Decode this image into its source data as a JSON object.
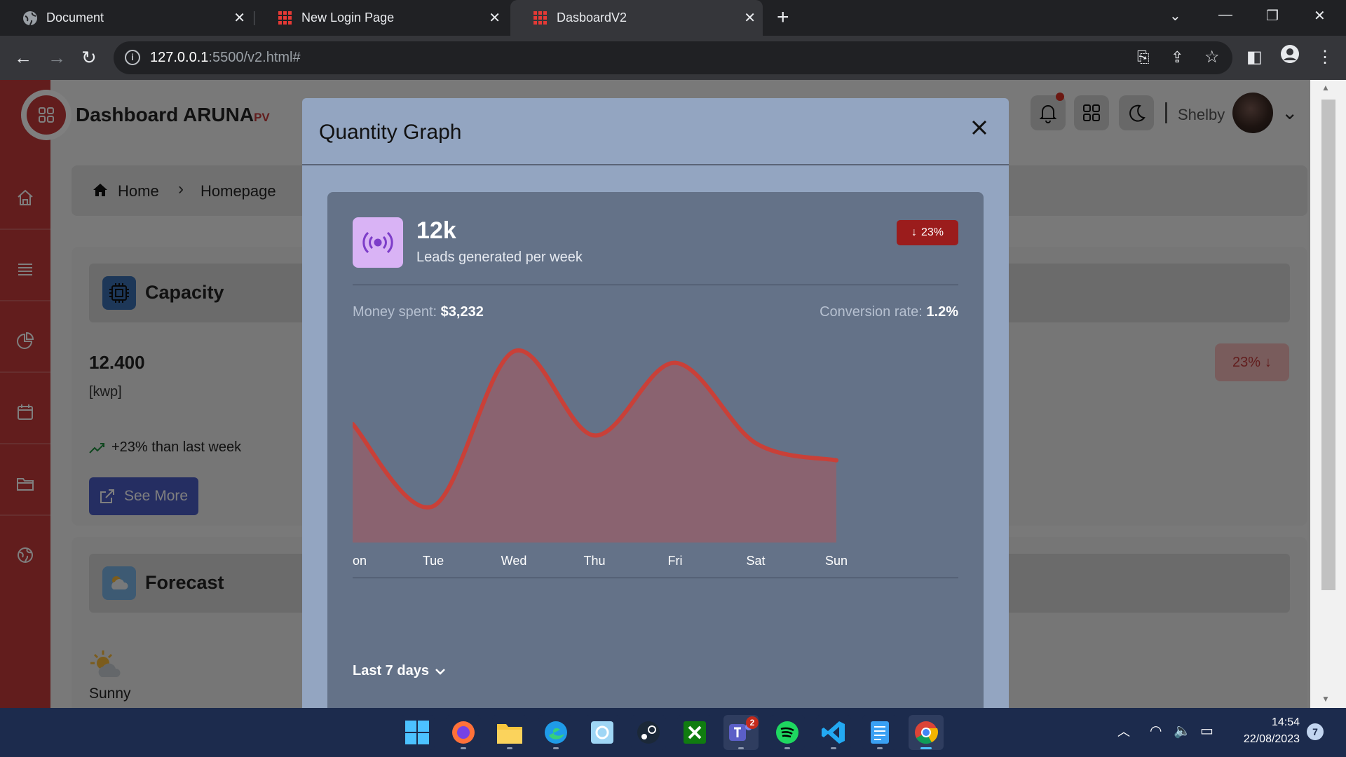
{
  "browser": {
    "tabs": [
      {
        "title": "Document",
        "favicon": "globe-icon"
      },
      {
        "title": "New Login Page",
        "favicon": "app-grid-icon"
      },
      {
        "title": "DasboardV2",
        "favicon": "app-grid-icon",
        "active": true
      }
    ],
    "url_host": "127.0.0.1",
    "url_rest": ":5500/v2.html#"
  },
  "app": {
    "title": "Dashboard ARUNA",
    "title_suffix": "PV",
    "username": "Shelby",
    "accent_color": "#c43a3a"
  },
  "breadcrumb": {
    "home": "Home",
    "current": "Homepage"
  },
  "capacity": {
    "title": "Capacity",
    "value": "12.400",
    "unit": "[kwp]",
    "trend": "+23% than last week",
    "see_more": "See More",
    "badge": "23%"
  },
  "forecast": {
    "title": "Forecast",
    "condition": "Sunny"
  },
  "modal": {
    "title": "Quantity Graph",
    "kpi_value": "12k",
    "kpi_subtitle": "Leads generated per week",
    "badge": "23%",
    "money_label": "Money spent:",
    "money_value": "$3,232",
    "conversion_label": "Conversion rate:",
    "conversion_value": "1.2%",
    "range_label": "Last 7 days"
  },
  "chart_data": {
    "type": "area",
    "categories": [
      "Mon",
      "Tue",
      "Wed",
      "Thu",
      "Fri",
      "Sat",
      "Sun"
    ],
    "visible_tick_labels": [
      "on",
      "Tue",
      "Wed",
      "Thu",
      "Fri",
      "Sat",
      "Sun"
    ],
    "series": [
      {
        "values": [
          6200,
          1900,
          10000,
          5600,
          9400,
          5200,
          4300
        ]
      }
    ],
    "ylim": [
      0,
      11000
    ],
    "grid": false,
    "line_color": "#c94038",
    "fill_color": "#8a6370"
  },
  "taskbar": {
    "apps": [
      "windows-start-icon",
      "firefox-icon",
      "file-explorer-icon",
      "edge-icon",
      "photos-icon",
      "steam-icon",
      "xbox-icon",
      "teams-icon",
      "spotify-icon",
      "vscode-icon",
      "notepad-icon",
      "chrome-icon"
    ],
    "teams_badge": "2",
    "time": "14:54",
    "date": "22/08/2023",
    "notification_count": "7"
  }
}
